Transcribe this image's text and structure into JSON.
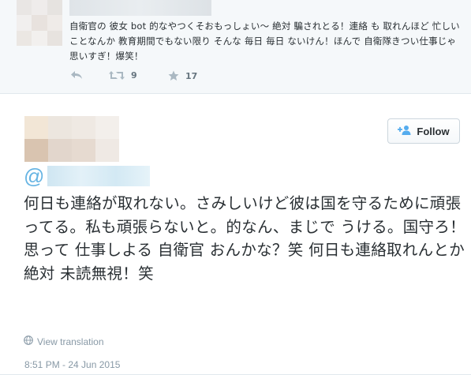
{
  "reply_tweet": {
    "text": "自衛官の 彼女 bot 的なやつくそおもっしょい～ 絶対 騙されとる！連絡 も 取れんほど 忙しいことなんか 教育期間でもない限り そんな 毎日 毎日 ないけん！ほんで 自衛隊きつい仕事じゃ 思いすぎ！爆笑！",
    "actions": {
      "reply_icon": "reply-icon",
      "retweet_icon": "retweet-icon",
      "retweet_count": "9",
      "favorite_icon": "star-icon",
      "favorite_count": "17"
    }
  },
  "main_tweet": {
    "follow_label": "Follow",
    "follow_icon": "add-user-icon",
    "at_symbol": "@",
    "text": "何日も連絡が取れない。さみしいけど彼は国を守るために頑張ってる。私も頑張らないと。的なん、まじで うける。国守ろ！思って 仕事しよる 自衛官 おんかな？笑 何日も連絡取れんとか 絶対 未読無視！笑",
    "translate_label": "View translation",
    "translate_icon": "globe-icon",
    "timestamp": "8:51 PM - 24 Jun 2015"
  },
  "colors": {
    "reply_background": "#f5f8fa",
    "link_blue": "#66b4e3",
    "muted_gray": "#8899a6"
  }
}
